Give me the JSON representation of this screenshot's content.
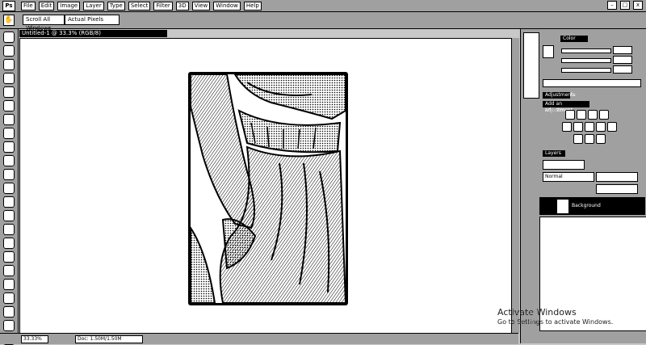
{
  "app": {
    "logo": "Ps"
  },
  "menubar": {
    "items": [
      "File",
      "Edit",
      "Image",
      "Layer",
      "Type",
      "Select",
      "Filter",
      "3D",
      "View",
      "Window",
      "Help"
    ]
  },
  "window_controls": {
    "minimize": "–",
    "maximize": "□",
    "close": "x"
  },
  "options_bar": {
    "tool_icon": "hand-icon",
    "scroll_all": "Scroll All Windows",
    "zoom_option": "Actual Pixels"
  },
  "document": {
    "tab_title": "Untitled-1 @ 33.3% (RGB/8)"
  },
  "statusbar": {
    "zoom": "33.33%",
    "info": "Doc: 1.50M/1.50M"
  },
  "panels": {
    "color_tab": "Color",
    "adjustments_tab": "Adjustments",
    "add_adjustment": "Add an adjustment",
    "layers_tab": "Layers",
    "blend_mode": "Normal",
    "layer_name": "Background"
  },
  "watermark": {
    "line1": "Activate Windows",
    "line2": "Go to Settings to activate Windows."
  },
  "colors": {
    "ink": "#000000",
    "paper": "#ffffff",
    "dither": "#d6d6d6"
  }
}
